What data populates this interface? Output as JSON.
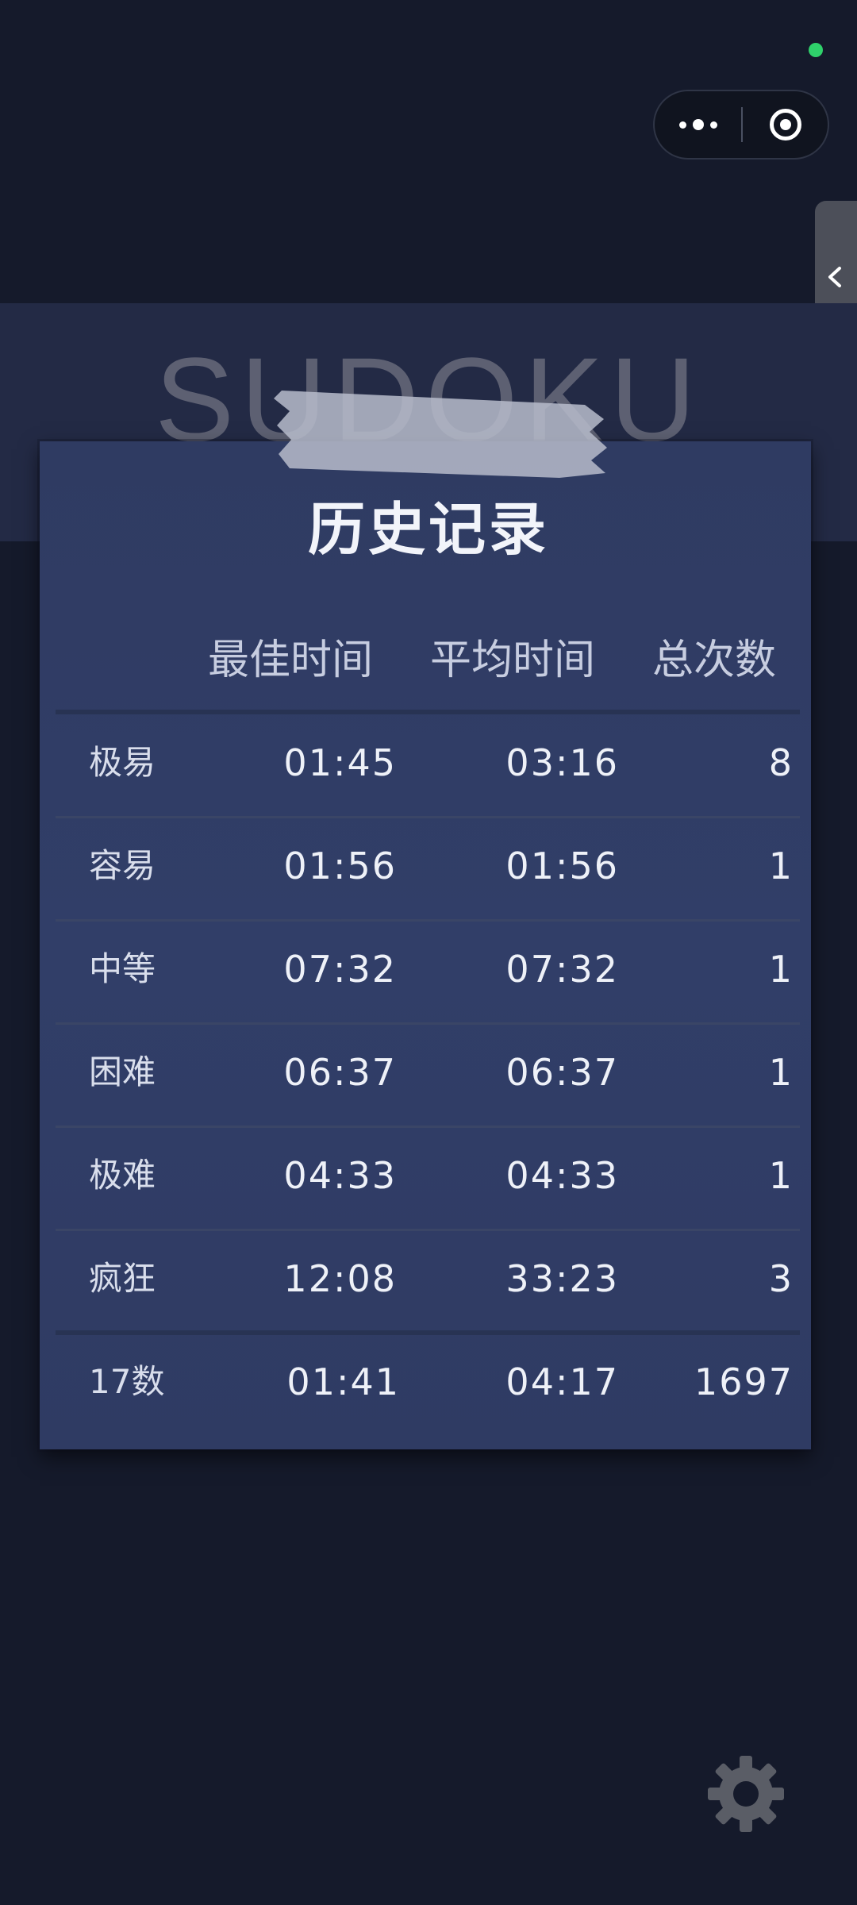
{
  "app": {
    "title": "SUDOKU"
  },
  "capsule": {
    "more_icon": "more-dots-icon",
    "close_icon": "mini-program-close-icon"
  },
  "side_tab": {
    "icon": "chevron-left-icon"
  },
  "history": {
    "title": "历史记录",
    "columns": [
      "最佳时间",
      "平均时间",
      "总次数"
    ],
    "rows": [
      {
        "level": "极易",
        "best": "01:45",
        "average": "03:16",
        "count": "8"
      },
      {
        "level": "容易",
        "best": "01:56",
        "average": "01:56",
        "count": "1"
      },
      {
        "level": "中等",
        "best": "07:32",
        "average": "07:32",
        "count": "1"
      },
      {
        "level": "困难",
        "best": "06:37",
        "average": "06:37",
        "count": "1"
      },
      {
        "level": "极难",
        "best": "04:33",
        "average": "04:33",
        "count": "1"
      },
      {
        "level": "疯狂",
        "best": "12:08",
        "average": "33:23",
        "count": "3"
      },
      {
        "level": "17数",
        "best": "01:41",
        "average": "04:17",
        "count": "1697"
      }
    ]
  },
  "settings": {
    "icon": "gear-icon"
  },
  "colors": {
    "background": "#151a2b",
    "header_band": "#232a45",
    "paper": "#313e68",
    "tape": "#b7bccb",
    "status_dot": "#2fd16b",
    "gear": "#5a5d66"
  }
}
